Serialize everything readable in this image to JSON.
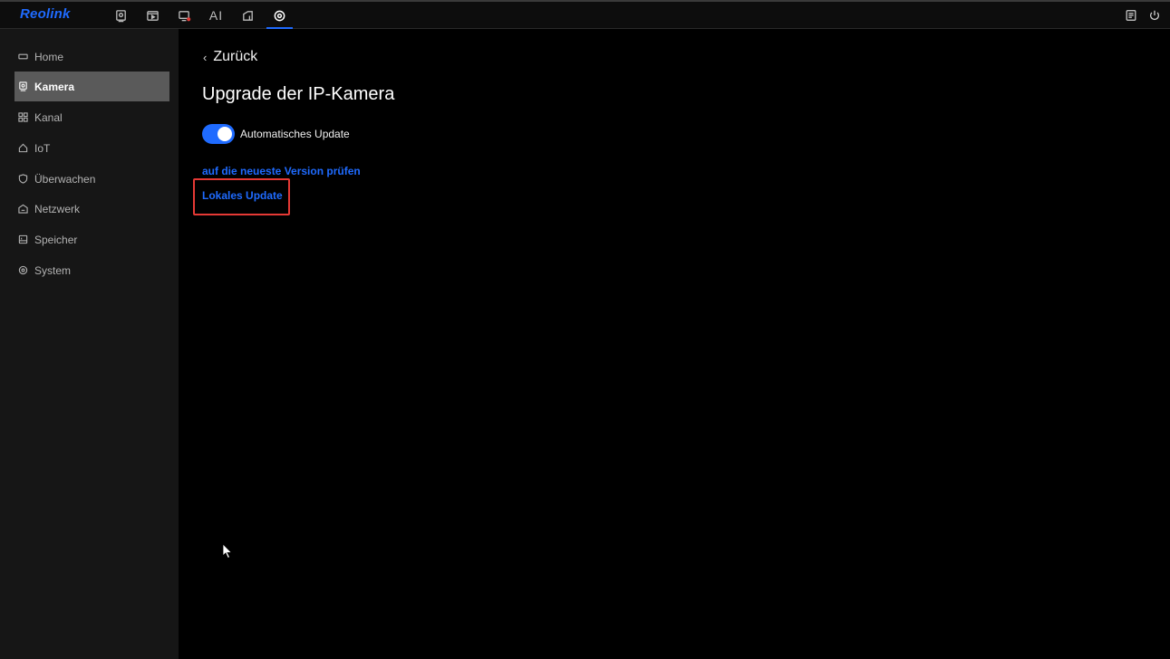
{
  "brand": {
    "logo_text": "Reolink",
    "accent": "#1f6bff"
  },
  "topbar": {
    "nav": [
      {
        "icon": "camera-live-icon"
      },
      {
        "icon": "playback-icon"
      },
      {
        "icon": "alarm-video-icon"
      },
      {
        "icon": "ai-icon",
        "label": "AI"
      },
      {
        "icon": "device-icon"
      },
      {
        "icon": "settings-icon",
        "active": true
      }
    ],
    "right": [
      {
        "icon": "notes-icon"
      },
      {
        "icon": "power-icon"
      }
    ]
  },
  "sidebar": {
    "items": [
      {
        "label": "Home",
        "icon": "home-icon"
      },
      {
        "label": "Kamera",
        "icon": "camera-icon",
        "active": true
      },
      {
        "label": "Kanal",
        "icon": "channel-grid-icon"
      },
      {
        "label": "IoT",
        "icon": "iot-house-icon"
      },
      {
        "label": "Überwachen",
        "icon": "shield-icon"
      },
      {
        "label": "Netzwerk",
        "icon": "network-icon"
      },
      {
        "label": "Speicher",
        "icon": "storage-icon"
      },
      {
        "label": "System",
        "icon": "system-gear-icon"
      }
    ]
  },
  "main": {
    "back_label": "Zurück",
    "title": "Upgrade der IP-Kamera",
    "auto_update": {
      "label": "Automatisches Update",
      "enabled": true
    },
    "check_link": "auf die neueste Version prüfen",
    "local_update_link": "Lokales Update"
  }
}
